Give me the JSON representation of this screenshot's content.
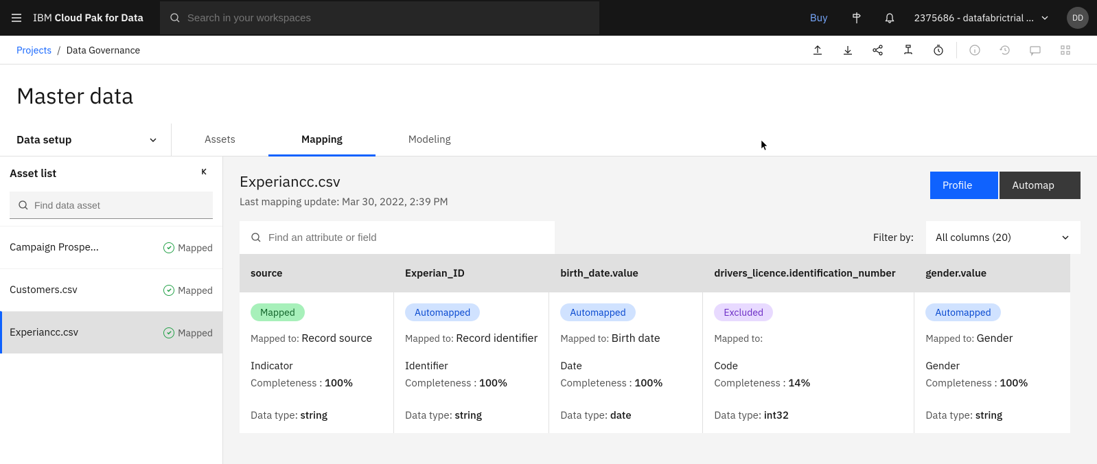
{
  "brand_prefix": "IBM",
  "brand_bold": "Cloud Pak for Data",
  "search_placeholder": "Search in your workspaces",
  "buy_label": "Buy",
  "account_label": "2375686 - datafabrictrial ...",
  "avatar_initials": "DD",
  "breadcrumb": {
    "link": "Projects",
    "sep": "/",
    "current": "Data Governance"
  },
  "page_title": "Master data",
  "left_tab": "Data setup",
  "tabs": {
    "assets": "Assets",
    "mapping": "Mapping",
    "modeling": "Modeling"
  },
  "asset_list_title": "Asset list",
  "asset_search_placeholder": "Find data asset",
  "asset_status_label": "Mapped",
  "assets": [
    {
      "name": "Campaign Prospe...",
      "status": "Mapped"
    },
    {
      "name": "Customers.csv",
      "status": "Mapped"
    },
    {
      "name": "Experiancc.csv",
      "status": "Mapped"
    }
  ],
  "file_title": "Experiancc.csv",
  "file_subtitle": "Last mapping update: Mar 30, 2022, 2:39 PM",
  "profile_btn": "Profile",
  "automap_btn": "Automap",
  "attr_search_placeholder": "Find an attribute or field",
  "filter_label": "Filter by:",
  "filter_value": "All columns (20)",
  "mapped_to_label": "Mapped to:",
  "completeness_label": "Completeness :",
  "data_type_label": "Data type:",
  "columns": [
    {
      "name": "source",
      "pill": "Mapped",
      "pill_class": "pill-green",
      "mapped_to": "Record source",
      "attr": "Indicator",
      "completeness": "100%",
      "dtype": "string"
    },
    {
      "name": "Experian_ID",
      "pill": "Automapped",
      "pill_class": "pill-blue",
      "mapped_to": "Record identifier",
      "attr": "Identifier",
      "completeness": "100%",
      "dtype": "string"
    },
    {
      "name": "birth_date.value",
      "pill": "Automapped",
      "pill_class": "pill-blue",
      "mapped_to": "Birth date",
      "attr": "Date",
      "completeness": "100%",
      "dtype": "date"
    },
    {
      "name": "drivers_licence.identification_number",
      "pill": "Excluded",
      "pill_class": "pill-purple",
      "mapped_to": "",
      "attr": "Code",
      "completeness": "14%",
      "dtype": "int32"
    },
    {
      "name": "gender.value",
      "pill": "Automapped",
      "pill_class": "pill-blue",
      "mapped_to": "Gender",
      "attr": "Gender",
      "completeness": "100%",
      "dtype": "string"
    }
  ]
}
